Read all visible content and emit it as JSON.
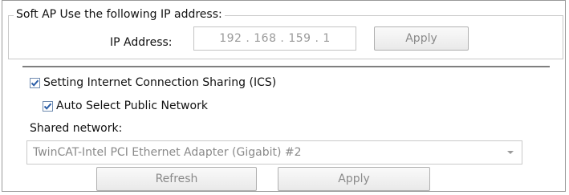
{
  "soft_ap_group": {
    "title": "Soft AP Use the following IP address:",
    "ip_label": "IP Address:",
    "ip_value": "192 . 168 . 159 .  1",
    "apply_label": "Apply"
  },
  "ics": {
    "setting_ics_label": "Setting Internet Connection Sharing (ICS)",
    "setting_ics_checked": true,
    "auto_select_label": "Auto Select Public Network",
    "auto_select_checked": true,
    "shared_network_label": "Shared network:",
    "shared_network_value": "TwinCAT-Intel PCI Ethernet Adapter (Gigabit) #2",
    "refresh_label": "Refresh",
    "apply_label": "Apply"
  },
  "colors": {
    "checkmark": "#2c5fa8",
    "disabled_text": "#8a8a8a"
  }
}
